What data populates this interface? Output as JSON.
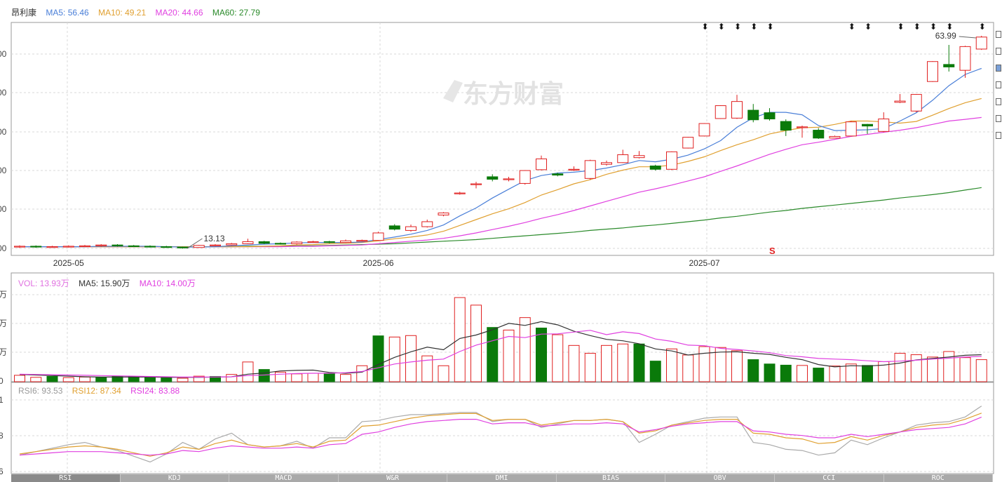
{
  "stock_name": "昂利康",
  "watermark": "东方财富",
  "price_legend": [
    {
      "label": "MA5: 56.46",
      "color": "#4a7fd8"
    },
    {
      "label": "MA10: 49.21",
      "color": "#e0a030"
    },
    {
      "label": "MA20: 44.66",
      "color": "#e040e0"
    },
    {
      "label": "MA60: 27.79",
      "color": "#2a8a2a"
    }
  ],
  "volume_legend": [
    {
      "label": "VOL: 13.93万",
      "color": "#e070e0"
    },
    {
      "label": "MA5: 15.90万",
      "color": "#333333"
    },
    {
      "label": "MA10: 14.00万",
      "color": "#e040e0"
    }
  ],
  "rsi_legend": [
    {
      "label": "RSI6: 93.53",
      "color": "#999999"
    },
    {
      "label": "RSI12: 87.34",
      "color": "#e0a030"
    },
    {
      "label": "RSI24: 83.88",
      "color": "#e040e0"
    }
  ],
  "indicator_tabs": [
    "RSI",
    "KDJ",
    "MACD",
    "W&R",
    "DMI",
    "BIAS",
    "OBV",
    "CCI",
    "ROC"
  ],
  "active_tab": 0,
  "side_icons": [
    "menu-icon",
    "checkbox-icon",
    "checkbox-checked-icon",
    "checkbox-icon",
    "checkbox-icon",
    "checkbox-icon",
    "checkbox-icon"
  ],
  "chart_data": [
    {
      "type": "candlestick",
      "x_axis_labels": [
        {
          "label": "2025-05",
          "index": 3
        },
        {
          "label": "2025-06",
          "index": 22
        },
        {
          "label": "2025-07",
          "index": 42
        }
      ],
      "candles": [
        {
          "o": 13.5,
          "c": 13.7,
          "h": 13.9,
          "l": 13.3
        },
        {
          "o": 13.7,
          "c": 13.5,
          "h": 13.9,
          "l": 13.3
        },
        {
          "o": 13.5,
          "c": 13.6,
          "h": 13.8,
          "l": 13.3
        },
        {
          "o": 13.6,
          "c": 13.7,
          "h": 13.9,
          "l": 13.4
        },
        {
          "o": 13.7,
          "c": 13.8,
          "h": 14.0,
          "l": 13.5
        },
        {
          "o": 13.8,
          "c": 14.0,
          "h": 14.2,
          "l": 13.6
        },
        {
          "o": 14.0,
          "c": 13.8,
          "h": 14.2,
          "l": 13.6
        },
        {
          "o": 13.8,
          "c": 13.7,
          "h": 14.0,
          "l": 13.5
        },
        {
          "o": 13.7,
          "c": 13.6,
          "h": 13.9,
          "l": 13.4
        },
        {
          "o": 13.6,
          "c": 13.5,
          "h": 13.8,
          "l": 13.3
        },
        {
          "o": 13.5,
          "c": 13.4,
          "h": 13.6,
          "l": 13.13
        },
        {
          "o": 13.4,
          "c": 13.9,
          "h": 14.0,
          "l": 13.3
        },
        {
          "o": 13.9,
          "c": 14.0,
          "h": 14.2,
          "l": 13.7
        },
        {
          "o": 14.0,
          "c": 14.3,
          "h": 14.5,
          "l": 13.9
        },
        {
          "o": 14.3,
          "c": 14.8,
          "h": 15.5,
          "l": 14.2
        },
        {
          "o": 14.8,
          "c": 14.4,
          "h": 15.0,
          "l": 14.2
        },
        {
          "o": 14.4,
          "c": 14.3,
          "h": 14.6,
          "l": 14.1
        },
        {
          "o": 14.3,
          "c": 14.7,
          "h": 14.9,
          "l": 14.1
        },
        {
          "o": 14.7,
          "c": 14.8,
          "h": 15.0,
          "l": 14.5
        },
        {
          "o": 14.8,
          "c": 14.6,
          "h": 15.0,
          "l": 14.4
        },
        {
          "o": 14.6,
          "c": 15.0,
          "h": 15.3,
          "l": 14.5
        },
        {
          "o": 15.0,
          "c": 15.1,
          "h": 15.3,
          "l": 14.8
        },
        {
          "o": 15.1,
          "c": 16.9,
          "h": 17.2,
          "l": 15.0
        },
        {
          "o": 18.6,
          "c": 17.8,
          "h": 19.0,
          "l": 17.5
        },
        {
          "o": 17.5,
          "c": 18.4,
          "h": 18.9,
          "l": 17.2
        },
        {
          "o": 18.4,
          "c": 19.6,
          "h": 20.1,
          "l": 18.2
        },
        {
          "o": 21.2,
          "c": 21.7,
          "h": 21.9,
          "l": 20.9
        },
        {
          "o": 26.3,
          "c": 26.5,
          "h": 26.8,
          "l": 26.1
        },
        {
          "o": 28.5,
          "c": 28.7,
          "h": 29.2,
          "l": 27.6
        },
        {
          "o": 30.4,
          "c": 29.8,
          "h": 31.0,
          "l": 29.3
        },
        {
          "o": 29.8,
          "c": 29.9,
          "h": 30.4,
          "l": 29.3
        },
        {
          "o": 28.8,
          "c": 31.9,
          "h": 32.0,
          "l": 28.5
        },
        {
          "o": 32.1,
          "c": 34.7,
          "h": 35.5,
          "l": 31.9
        },
        {
          "o": 31.1,
          "c": 30.8,
          "h": 31.4,
          "l": 30.5
        },
        {
          "o": 32.0,
          "c": 32.2,
          "h": 32.9,
          "l": 31.8
        },
        {
          "o": 30.0,
          "c": 34.3,
          "h": 34.5,
          "l": 29.7
        },
        {
          "o": 33.4,
          "c": 33.8,
          "h": 34.3,
          "l": 33.1
        },
        {
          "o": 33.8,
          "c": 35.7,
          "h": 36.9,
          "l": 33.7
        },
        {
          "o": 35.0,
          "c": 35.5,
          "h": 36.6,
          "l": 34.8
        },
        {
          "o": 33.0,
          "c": 32.2,
          "h": 33.3,
          "l": 31.9
        },
        {
          "o": 32.2,
          "c": 36.4,
          "h": 36.5,
          "l": 32.0
        },
        {
          "o": 37.3,
          "c": 39.9,
          "h": 40.0,
          "l": 37.2
        },
        {
          "o": 40.2,
          "c": 43.2,
          "h": 43.3,
          "l": 40.1
        },
        {
          "o": 44.4,
          "c": 47.5,
          "h": 47.6,
          "l": 44.3
        },
        {
          "o": 44.5,
          "c": 48.5,
          "h": 50.1,
          "l": 44.3
        },
        {
          "o": 46.4,
          "c": 44.1,
          "h": 47.9,
          "l": 43.5
        },
        {
          "o": 45.8,
          "c": 44.3,
          "h": 46.9,
          "l": 43.9
        },
        {
          "o": 43.7,
          "c": 41.6,
          "h": 44.2,
          "l": 40.2
        },
        {
          "o": 42.2,
          "c": 42.4,
          "h": 42.7,
          "l": 39.8
        },
        {
          "o": 41.6,
          "c": 39.7,
          "h": 42.1,
          "l": 39.5
        },
        {
          "o": 39.7,
          "c": 40.1,
          "h": 40.3,
          "l": 39.8
        },
        {
          "o": 40.2,
          "c": 43.6,
          "h": 43.8,
          "l": 40.1
        },
        {
          "o": 43.0,
          "c": 42.6,
          "h": 43.1,
          "l": 40.7
        },
        {
          "o": 41.3,
          "c": 44.3,
          "h": 45.9,
          "l": 41.1
        },
        {
          "o": 48.3,
          "c": 48.6,
          "h": 50.3,
          "l": 48.1
        },
        {
          "o": 46.2,
          "c": 50.2,
          "h": 50.3,
          "l": 45.9
        },
        {
          "o": 53.3,
          "c": 58.1,
          "h": 58.2,
          "l": 53.2
        },
        {
          "o": 57.4,
          "c": 56.8,
          "h": 62.1,
          "l": 55.7
        },
        {
          "o": 56.0,
          "c": 61.7,
          "h": 61.9,
          "l": 54.2
        },
        {
          "o": 61.1,
          "c": 63.99,
          "h": 64.3,
          "l": 60.9
        }
      ],
      "ma5": [
        13.6,
        13.6,
        13.6,
        13.6,
        13.6,
        13.7,
        13.7,
        13.7,
        13.7,
        13.6,
        13.5,
        13.5,
        13.6,
        13.8,
        14.0,
        14.2,
        14.3,
        14.5,
        14.6,
        14.6,
        14.6,
        14.7,
        15.3,
        15.9,
        16.6,
        17.5,
        18.8,
        21.0,
        22.9,
        25.3,
        27.4,
        29.5,
        30.7,
        31.3,
        31.5,
        31.9,
        32.5,
        33.3,
        34.3,
        34.0,
        34.6,
        35.6,
        37.1,
        39.1,
        42.3,
        44.6,
        45.9,
        45.9,
        45.3,
        42.7,
        41.5,
        41.6,
        41.7,
        42.0,
        43.8,
        45.8,
        48.8,
        52.3,
        55.0,
        56.46
      ],
      "ma10": [
        13.6,
        13.6,
        13.6,
        13.6,
        13.6,
        13.6,
        13.6,
        13.6,
        13.6,
        13.6,
        13.6,
        13.6,
        13.6,
        13.6,
        13.6,
        13.7,
        13.8,
        14.0,
        14.1,
        14.3,
        14.4,
        14.6,
        15.0,
        15.5,
        15.9,
        16.4,
        17.3,
        18.7,
        20.1,
        21.5,
        22.7,
        24.2,
        26.0,
        27.3,
        28.7,
        29.7,
        31.0,
        32.0,
        32.8,
        32.8,
        33.2,
        34.1,
        35.2,
        36.7,
        38.1,
        39.3,
        40.7,
        41.5,
        42.2,
        42.3,
        43.0,
        43.8,
        43.8,
        43.6,
        43.3,
        43.7,
        45.2,
        46.8,
        48.2,
        49.21
      ],
      "ma20": [
        13.6,
        13.6,
        13.6,
        13.6,
        13.6,
        13.6,
        13.6,
        13.6,
        13.6,
        13.6,
        13.6,
        13.6,
        13.6,
        13.6,
        13.6,
        13.6,
        13.6,
        13.7,
        13.7,
        13.8,
        13.9,
        14.0,
        14.3,
        14.6,
        14.9,
        15.2,
        15.6,
        16.2,
        16.9,
        17.7,
        18.5,
        19.4,
        20.4,
        21.3,
        22.3,
        23.4,
        24.5,
        25.6,
        26.7,
        27.5,
        28.4,
        29.4,
        30.4,
        31.7,
        33.0,
        34.4,
        35.8,
        37.0,
        38.1,
        38.7,
        39.4,
        40.1,
        40.6,
        41.1,
        41.6,
        42.2,
        43.0,
        43.8,
        44.2,
        44.66
      ],
      "ma60": [
        13.6,
        13.6,
        13.6,
        13.6,
        13.6,
        13.6,
        13.6,
        13.6,
        13.6,
        13.6,
        13.6,
        13.6,
        13.6,
        13.6,
        13.7,
        13.7,
        13.7,
        13.8,
        13.8,
        13.9,
        14.0,
        14.1,
        14.2,
        14.3,
        14.5,
        14.7,
        14.9,
        15.1,
        15.3,
        15.6,
        15.9,
        16.2,
        16.5,
        16.8,
        17.1,
        17.5,
        17.8,
        18.1,
        18.5,
        18.8,
        19.2,
        19.6,
        20.0,
        20.5,
        20.9,
        21.4,
        21.9,
        22.3,
        22.8,
        23.2,
        23.6,
        24.0,
        24.4,
        24.8,
        25.3,
        25.7,
        26.1,
        26.6,
        27.2,
        27.79
      ],
      "max_label": "63.99",
      "min_label": "13.13",
      "markers": [
        42,
        43,
        44,
        45,
        46,
        51,
        52,
        54,
        55,
        56,
        57,
        59
      ]
    },
    {
      "type": "bar",
      "name": "volume",
      "values": [
        2.2,
        1.5,
        1.8,
        1.4,
        1.6,
        1.5,
        1.8,
        1.7,
        1.4,
        1.3,
        1.2,
        1.9,
        1.8,
        2.5,
        6.8,
        4.2,
        3.3,
        2.7,
        2.9,
        2.9,
        2.5,
        5.5,
        15.8,
        15.4,
        15.9,
        8.9,
        5.5,
        29.0,
        26.4,
        18.7,
        17.8,
        22.1,
        18.5,
        16.2,
        12.5,
        9.8,
        12.5,
        13.0,
        13.0,
        7.1,
        11.3,
        9.2,
        12.1,
        11.8,
        10.7,
        7.6,
        6.1,
        5.7,
        5.6,
        4.7,
        5.4,
        6.1,
        5.6,
        6.9,
        9.8,
        9.3,
        8.5,
        10.4,
        8.3,
        7.6
      ],
      "up": [
        true,
        true,
        false,
        true,
        true,
        false,
        false,
        false,
        false,
        false,
        true,
        true,
        false,
        true,
        true,
        false,
        true,
        true,
        true,
        false,
        true,
        true,
        false,
        true,
        true,
        true,
        true,
        true,
        true,
        false,
        true,
        true,
        false,
        true,
        true,
        true,
        true,
        true,
        false,
        false,
        true,
        true,
        true,
        true,
        true,
        false,
        false,
        false,
        true,
        false,
        true,
        true,
        false,
        true,
        true,
        true,
        true,
        true,
        true,
        true
      ],
      "ma5": [
        2.5,
        2.3,
        2.1,
        1.9,
        1.7,
        1.6,
        1.6,
        1.6,
        1.6,
        1.5,
        1.5,
        1.5,
        1.6,
        1.7,
        2.6,
        3.0,
        3.7,
        3.9,
        4.0,
        3.2,
        2.9,
        3.3,
        5.9,
        8.4,
        10.3,
        11.9,
        11.0,
        14.9,
        16.1,
        17.9,
        20.1,
        19.4,
        20.7,
        19.6,
        17.4,
        15.9,
        14.6,
        14.1,
        13.1,
        11.3,
        10.6,
        9.2,
        9.8,
        10.2,
        10.3,
        9.8,
        9.4,
        8.4,
        7.6,
        5.9,
        5.1,
        5.5,
        5.4,
        5.7,
        6.4,
        7.5,
        8.0,
        8.5,
        9.1,
        9.3
      ],
      "ma10": [
        2.6,
        2.5,
        2.4,
        2.3,
        2.2,
        2.1,
        2.0,
        1.9,
        1.8,
        1.7,
        1.6,
        1.6,
        1.6,
        1.7,
        2.1,
        2.3,
        2.6,
        2.8,
        2.9,
        2.9,
        3.1,
        3.5,
        4.8,
        6.1,
        6.8,
        7.4,
        7.8,
        10.4,
        12.6,
        14.1,
        15.6,
        15.2,
        16.4,
        16.5,
        17.1,
        17.7,
        16.2,
        17.2,
        16.6,
        14.7,
        13.9,
        12.6,
        12.4,
        11.5,
        11.1,
        10.6,
        10.0,
        9.0,
        8.6,
        8.0,
        7.8,
        7.6,
        7.2,
        6.9,
        7.1,
        7.4,
        7.8,
        8.1,
        8.5,
        8.7
      ],
      "ymax": 30
    },
    {
      "type": "line",
      "name": "rsi",
      "rsi6": [
        52,
        55,
        51,
        54,
        57,
        60,
        62,
        58,
        55,
        50,
        45,
        52,
        62,
        56,
        65,
        70,
        60,
        58,
        59,
        63,
        57,
        66,
        66,
        80,
        81,
        84,
        86,
        86,
        87,
        88,
        88,
        80,
        82,
        82,
        75,
        78,
        81,
        81,
        82,
        80,
        62,
        69,
        77,
        80,
        83,
        84,
        84,
        62,
        60,
        56,
        55,
        51,
        53,
        64,
        60,
        66,
        71,
        77,
        79,
        80,
        84,
        93.53
      ],
      "rsi12": [
        52,
        54,
        52,
        54,
        56,
        58,
        59,
        58,
        56,
        53,
        50,
        53,
        58,
        56,
        61,
        64,
        60,
        58,
        59,
        61,
        58,
        63,
        64,
        76,
        77,
        80,
        83,
        85,
        86,
        87,
        87,
        81,
        82,
        82,
        77,
        79,
        81,
        81,
        82,
        80,
        70,
        72,
        77,
        79,
        81,
        82,
        82,
        70,
        69,
        66,
        65,
        61,
        62,
        67,
        64,
        68,
        71,
        75,
        77,
        78,
        82,
        87.34
      ],
      "rsi24": [
        51,
        52,
        51,
        52,
        53,
        54,
        54,
        54,
        53,
        52,
        51,
        52,
        55,
        54,
        57,
        59,
        58,
        57,
        57,
        58,
        57,
        60,
        61,
        69,
        71,
        75,
        78,
        80,
        81,
        82,
        82,
        78,
        79,
        79,
        76,
        77,
        78,
        78,
        79,
        78,
        71,
        73,
        76,
        78,
        79,
        80,
        80,
        72,
        71,
        69,
        68,
        66,
        66,
        69,
        67,
        69,
        71,
        73,
        74,
        75,
        78,
        83.88
      ],
      "ymin": 35,
      "ymax": 100
    }
  ]
}
